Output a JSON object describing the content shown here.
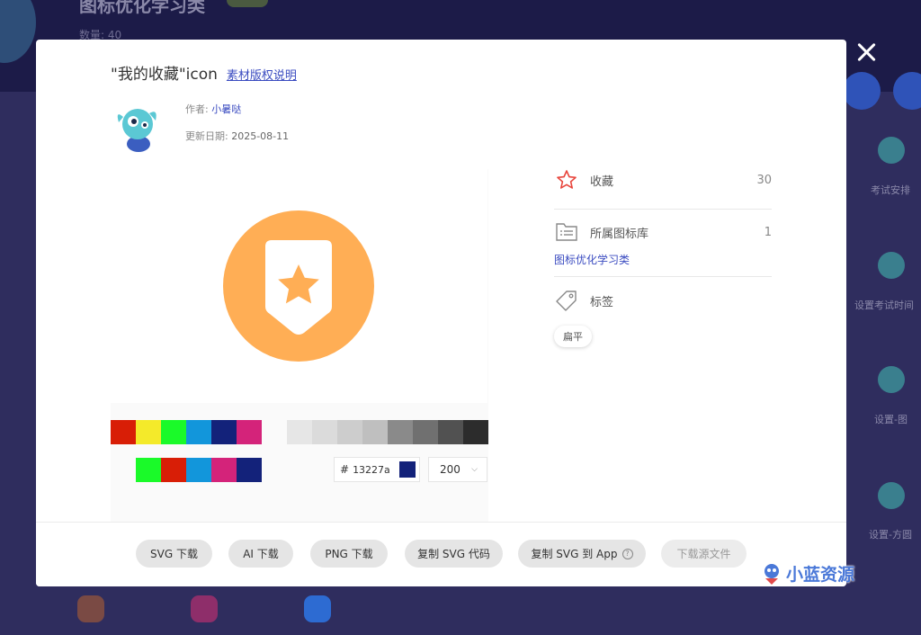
{
  "background": {
    "title": "图标优化学习类",
    "count": "数量: 40",
    "side_labels": [
      "考试安排",
      "设置考试时间",
      "设置-图",
      "设置-方圆"
    ]
  },
  "modal": {
    "title": "\"我的收藏\"icon",
    "license_link": "素材版权说明",
    "author_label": "作者:",
    "author_name": "小暑哒",
    "date_label": "更新日期:",
    "date": "2025-08-11",
    "icon_color": "#FFAE55"
  },
  "colors": {
    "row1": [
      "#D81E06",
      "#F4EA2A",
      "#1AFA29",
      "#1296DB",
      "#13227A",
      "#D4237A"
    ],
    "row1_gray": [
      "#E6E6E6",
      "#DBDBDB",
      "#CDCDCD",
      "#BFBFBF",
      "#8A8A8A",
      "#707070",
      "#515151",
      "#2C2C2C"
    ],
    "row2": [
      "#1AFA29",
      "#D81E06",
      "#1296DB",
      "#D4237A",
      "#13227A"
    ],
    "hex_symbol": "#",
    "hex_value": "13227a",
    "size": "200"
  },
  "sidebar": {
    "favorite_label": "收藏",
    "favorite_count": "30",
    "library_label": "所属图标库",
    "library_count": "1",
    "library_name": "图标优化学习类",
    "tags_label": "标签",
    "tag": "扁平"
  },
  "footer": {
    "svg_download": "SVG 下载",
    "ai_download": "AI 下载",
    "png_download": "PNG 下载",
    "copy_svg_code": "复制 SVG 代码",
    "copy_svg_app": "复制 SVG 到 App",
    "help": "?",
    "download_source": "下载源文件"
  },
  "watermark": "小蓝资源"
}
